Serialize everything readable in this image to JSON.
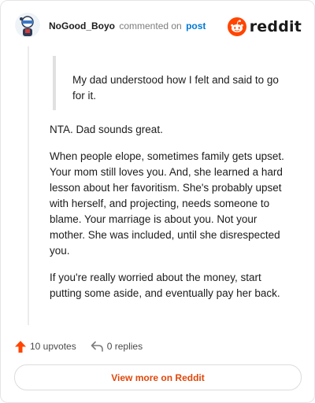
{
  "header": {
    "username": "NoGood_Boyo",
    "commented_text": "commented on",
    "post_link": "post",
    "brand": "reddit"
  },
  "quote": {
    "text": "My dad understood how I felt and said to go for it."
  },
  "comment": {
    "paragraphs": [
      "NTA. Dad sounds great.",
      "When people elope, sometimes family gets upset. Your mom still loves you. And, she learned a hard lesson about her favoritism. She's probably upset with herself, and projecting, needs someone to blame. Your marriage is about you. Not your mother. She was included, until she disrespected you.",
      "If you're really worried about the money, start putting some aside, and eventually pay her back."
    ]
  },
  "footer": {
    "upvotes": "10 upvotes",
    "replies": "0 replies",
    "view_button": "View more on Reddit"
  },
  "colors": {
    "brand_orange": "#ff4500",
    "link_blue": "#0079d3",
    "button_text": "#e0470a"
  },
  "icons": {
    "upvote": "arrow-up-icon",
    "reply": "reply-arrow-icon",
    "brand": "reddit-snoo-icon"
  }
}
